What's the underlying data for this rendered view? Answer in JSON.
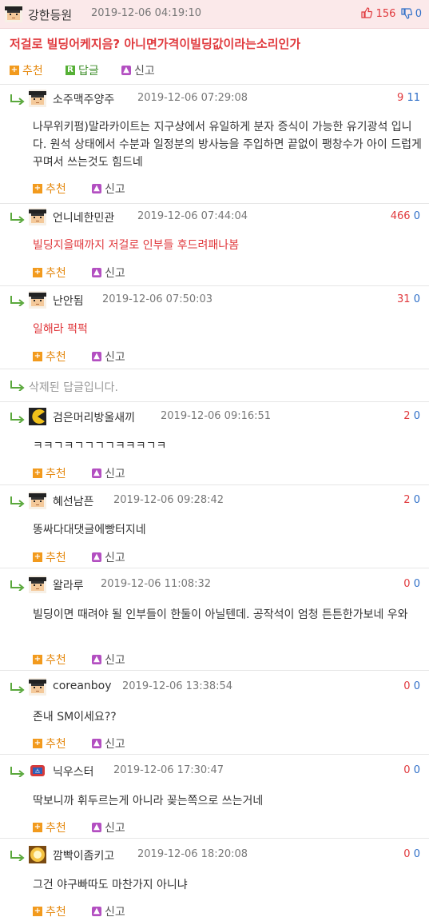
{
  "post": {
    "author": "강한등원",
    "time": "2019-12-06 04:19:10",
    "upvotes": "156",
    "downvotes": "0",
    "title": "저걸로 빌딩어케지음? 아니면가격이빌딩값이라는소리인가",
    "actions": {
      "recommend": "추천",
      "reply": "답글",
      "report": "신고"
    }
  },
  "comments": [
    {
      "name": "소주맥주양주",
      "time": "2019-12-06 07:29:08",
      "up": "9",
      "down": "11",
      "text": "나무위키펌)말라카이트는 지구상에서 유일하게 분자 증식이 가능한 유기광석 입니다. 원석 상태에서 수분과 일정분의 방사능을 주입하면 끝없이 팽창수가 아이 드럽게 꾸며서 쓰는것도 힘드네",
      "recommend": "추천",
      "report": "신고"
    },
    {
      "name": "언니네한민관",
      "time": "2019-12-06 07:44:04",
      "up": "466",
      "down": "0",
      "text": "빌딩지을때까지 저걸로 인부들 후드려패나봄",
      "recommend": "추천",
      "report": "신고"
    },
    {
      "name": "난안됨",
      "time": "2019-12-06 07:50:03",
      "up": "31",
      "down": "0",
      "text": "일해라 퍽퍽",
      "recommend": "추천",
      "report": "신고"
    },
    {
      "deleted_text": "삭제된 답글입니다."
    },
    {
      "name": "검은머리방울새끼",
      "time": "2019-12-06 09:16:51",
      "up": "2",
      "down": "0",
      "text": "ㅋㅋㄱㅋㄱㄱㄱㄱㅋㅋㅋㄱㅋ",
      "recommend": "추천",
      "report": "신고"
    },
    {
      "name": "혜선남픈",
      "time": "2019-12-06 09:28:42",
      "up": "2",
      "down": "0",
      "text": "똥싸다대댓글에빵터지네",
      "recommend": "추천",
      "report": "신고"
    },
    {
      "name": "왈라루",
      "time": "2019-12-06 11:08:32",
      "up": "0",
      "down": "0",
      "text": "빌딩이면 때려야 될 인부들이 한둘이 아닐텐데. 공작석이 엄청 튼튼한가보네 우와",
      "recommend": "추천",
      "report": "신고"
    },
    {
      "name": "coreanboy",
      "time": "2019-12-06 13:38:54",
      "up": "0",
      "down": "0",
      "text": "존내 SM이세요??",
      "recommend": "추천",
      "report": "신고"
    },
    {
      "name": "닉우스터",
      "time": "2019-12-06 17:30:47",
      "up": "0",
      "down": "0",
      "text": "딱보니까 휘두르는게 아니라 꽂는쪽으로 쓰는거네",
      "recommend": "추천",
      "report": "신고"
    },
    {
      "name": "깜빡이좀키고",
      "time": "2019-12-06 18:20:08",
      "up": "0",
      "down": "0",
      "text": "그건 야구빠따도 마찬가지 아니냐",
      "recommend": "추천",
      "report": "신고"
    }
  ]
}
